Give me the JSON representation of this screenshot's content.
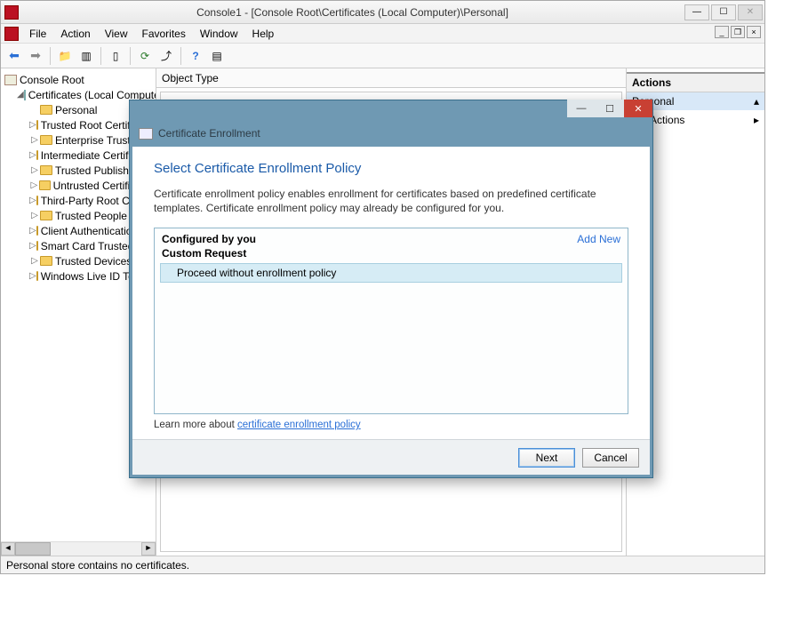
{
  "window": {
    "title": "Console1 - [Console Root\\Certificates (Local Computer)\\Personal]"
  },
  "menu": {
    "file": "File",
    "action": "Action",
    "view": "View",
    "favorites": "Favorites",
    "window": "Window",
    "help": "Help"
  },
  "tree": {
    "root": "Console Root",
    "certs": "Certificates (Local Computer)",
    "items": [
      "Personal",
      "Trusted Root Certification Authorities",
      "Enterprise Trust",
      "Intermediate Certification Authorities",
      "Trusted Publishers",
      "Untrusted Certificates",
      "Third-Party Root Certification Authorities",
      "Trusted People",
      "Client Authentication Issuers",
      "Smart Card Trusted Roots",
      "Trusted Devices",
      "Windows Live ID Token Issuer"
    ]
  },
  "center": {
    "column_header": "Object Type"
  },
  "actions": {
    "header": "Actions",
    "group_title": "Personal",
    "more_actions_suffix": "ore Actions"
  },
  "statusbar": "Personal store contains no certificates.",
  "dialog": {
    "title": "Certificate Enrollment",
    "heading": "Select Certificate Enrollment Policy",
    "description": "Certificate enrollment policy enables enrollment for certificates based on predefined certificate templates. Certificate enrollment policy may already be configured for you.",
    "configured_by_you": "Configured by you",
    "add_new": "Add New",
    "custom_request": "Custom Request",
    "proceed_item": "Proceed without enrollment policy",
    "learn_prefix": "Learn more about ",
    "learn_link": "certificate enrollment policy",
    "next": "Next",
    "cancel": "Cancel"
  }
}
